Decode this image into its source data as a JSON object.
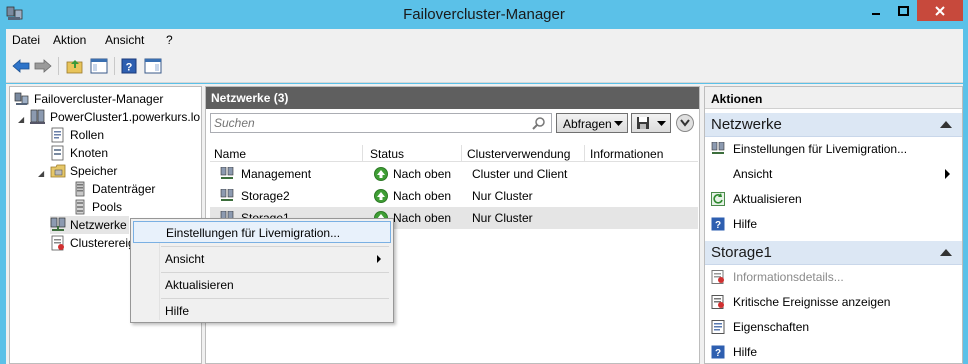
{
  "window": {
    "title": "Failovercluster-Manager",
    "min_label": "–",
    "max_label": "□",
    "close_label": "✕"
  },
  "menubar": {
    "items": [
      "Datei",
      "Aktion",
      "Ansicht",
      "?"
    ]
  },
  "toolbar": {
    "icons": [
      "back-arrow-icon",
      "forward-arrow-icon",
      "folder-up-icon",
      "console-tree-icon",
      "help-icon",
      "action-pane-icon"
    ]
  },
  "tree": {
    "root": "Failovercluster-Manager",
    "cluster": "PowerCluster1.powerkurs.lo",
    "items": [
      "Rollen",
      "Knoten",
      "Speicher",
      "Datenträger",
      "Pools",
      "Netzwerke",
      "Clusterereignisse"
    ]
  },
  "center": {
    "header": "Netzwerke (3)",
    "search_placeholder": "Suchen",
    "query_label": "Abfragen",
    "columns": [
      "Name",
      "Status",
      "Clusterverwendung",
      "Informationen"
    ],
    "rows": [
      {
        "name": "Management",
        "status": "Nach oben",
        "usage": "Cluster und Client",
        "info": ""
      },
      {
        "name": "Storage2",
        "status": "Nach oben",
        "usage": "Nur Cluster",
        "info": ""
      },
      {
        "name": "Storage1",
        "status": "Nach oben",
        "usage": "Nur Cluster",
        "info": ""
      }
    ]
  },
  "actions": {
    "title": "Aktionen",
    "section1": "Netzwerke",
    "section1_items": [
      "Einstellungen für Livemigration...",
      "Ansicht",
      "Aktualisieren",
      "Hilfe"
    ],
    "section2": "Storage1",
    "section2_items": [
      "Informationsdetails...",
      "Kritische Ereignisse anzeigen",
      "Eigenschaften",
      "Hilfe"
    ]
  },
  "context_menu": {
    "items": [
      "Einstellungen für Livemigration...",
      "Ansicht",
      "Aktualisieren",
      "Hilfe"
    ]
  },
  "colors": {
    "titlebar": "#5bc1e8",
    "close": "#c7493c",
    "header_bar": "#5f5f5f",
    "section_bg": "#dce7f4",
    "status_green": "#3f9e35"
  }
}
